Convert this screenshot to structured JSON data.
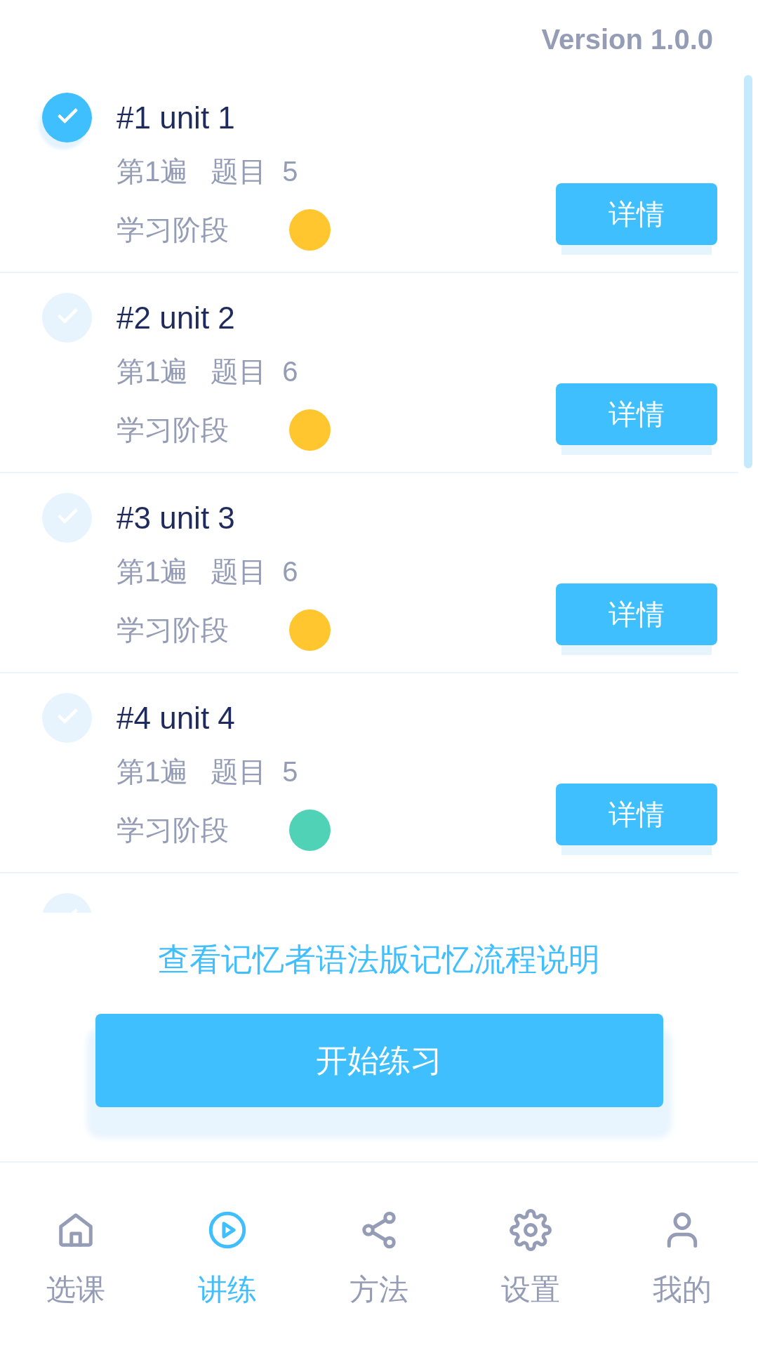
{
  "version": "Version 1.0.0",
  "units": [
    {
      "title": "#1 unit 1",
      "checked": true,
      "pass": "第1遍",
      "questions_label": "题目",
      "questions": "5",
      "stage_label": "学习阶段",
      "color": "#ffc630",
      "detail_button": "详情"
    },
    {
      "title": "#2 unit 2",
      "checked": false,
      "pass": "第1遍",
      "questions_label": "题目",
      "questions": "6",
      "stage_label": "学习阶段",
      "color": "#ffc630",
      "detail_button": "详情"
    },
    {
      "title": "#3 unit 3",
      "checked": false,
      "pass": "第1遍",
      "questions_label": "题目",
      "questions": "6",
      "stage_label": "学习阶段",
      "color": "#ffc630",
      "detail_button": "详情"
    },
    {
      "title": "#4 unit 4",
      "checked": false,
      "pass": "第1遍",
      "questions_label": "题目",
      "questions": "5",
      "stage_label": "学习阶段",
      "color": "#50d2b6",
      "detail_button": "详情"
    },
    {
      "checked": false
    }
  ],
  "flow_link": "查看记忆者语法版记忆流程说明",
  "start_button": "开始练习",
  "tabs": [
    {
      "label": "选课",
      "selected": false
    },
    {
      "label": "讲练",
      "selected": true
    },
    {
      "label": "方法",
      "selected": false
    },
    {
      "label": "设置",
      "selected": false
    },
    {
      "label": "我的",
      "selected": false
    }
  ]
}
